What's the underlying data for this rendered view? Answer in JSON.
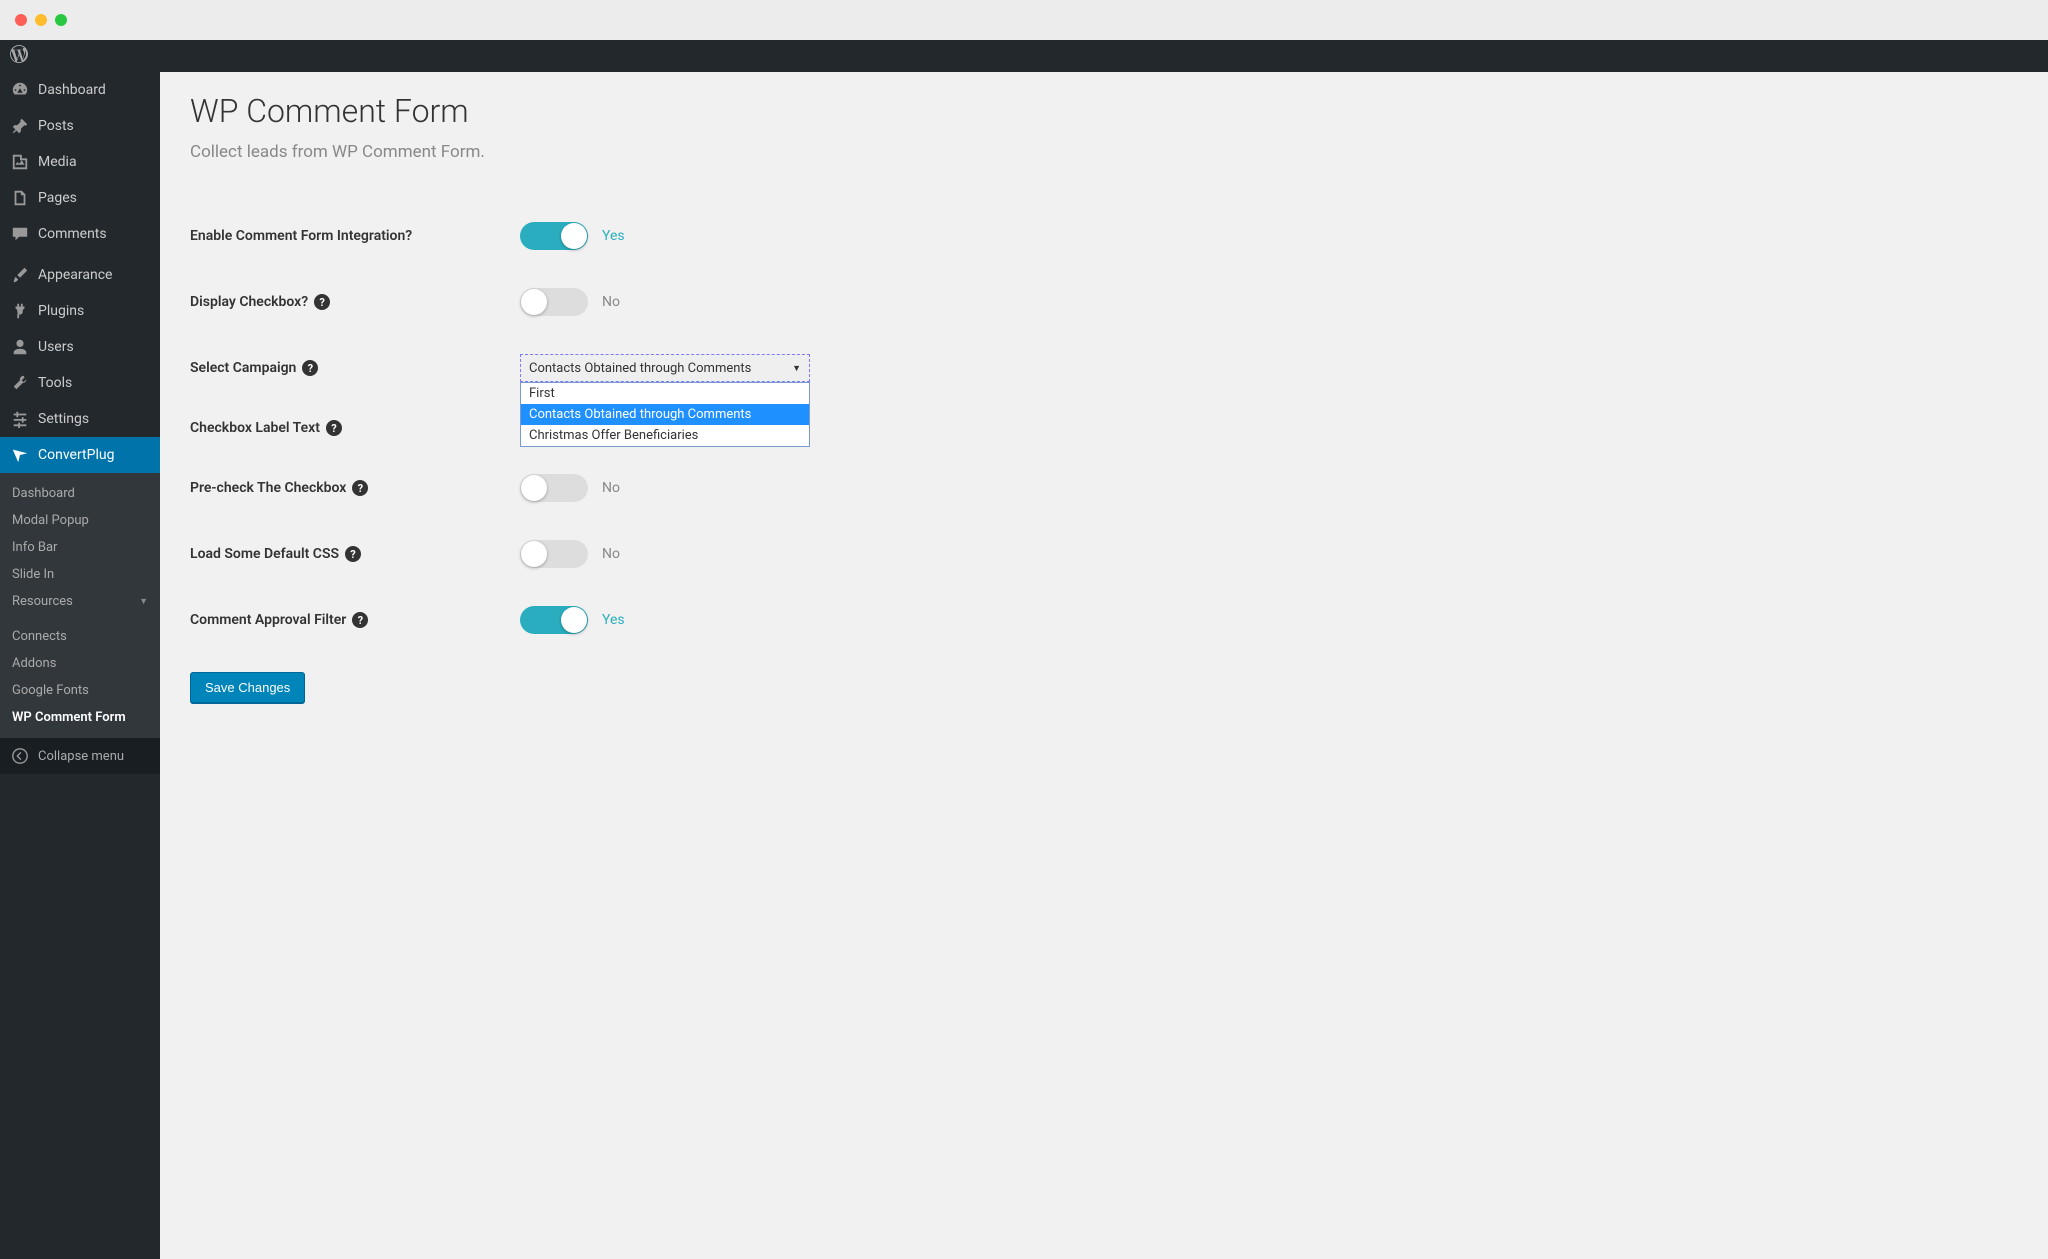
{
  "sidebar": {
    "items": [
      {
        "label": "Dashboard",
        "icon": "dashboard"
      },
      {
        "label": "Posts",
        "icon": "pin"
      },
      {
        "label": "Media",
        "icon": "media"
      },
      {
        "label": "Pages",
        "icon": "pages"
      },
      {
        "label": "Comments",
        "icon": "comment"
      },
      {
        "label": "Appearance",
        "icon": "brush"
      },
      {
        "label": "Plugins",
        "icon": "plug"
      },
      {
        "label": "Users",
        "icon": "user"
      },
      {
        "label": "Tools",
        "icon": "wrench"
      },
      {
        "label": "Settings",
        "icon": "sliders"
      },
      {
        "label": "ConvertPlug",
        "icon": "convertplug"
      }
    ],
    "subitems": [
      {
        "label": "Dashboard"
      },
      {
        "label": "Modal Popup"
      },
      {
        "label": "Info Bar"
      },
      {
        "label": "Slide In"
      },
      {
        "label": "Resources",
        "chevron": true
      },
      {
        "label": "Connects"
      },
      {
        "label": "Addons"
      },
      {
        "label": "Google Fonts"
      },
      {
        "label": "WP Comment Form",
        "current": true
      }
    ],
    "collapse": "Collapse menu"
  },
  "page": {
    "title": "WP Comment Form",
    "subtitle": "Collect leads from WP Comment Form."
  },
  "form": {
    "rows": [
      {
        "label": "Enable Comment Form Integration?",
        "help": false,
        "type": "toggle",
        "value": true
      },
      {
        "label": "Display Checkbox?",
        "help": true,
        "type": "toggle",
        "value": false
      },
      {
        "label": "Select Campaign",
        "help": true,
        "type": "select",
        "selected": "Contacts Obtained through Comments"
      },
      {
        "label": "Checkbox Label Text",
        "help": true,
        "type": "none"
      },
      {
        "label": "Pre-check The Checkbox",
        "help": true,
        "type": "toggle",
        "value": false
      },
      {
        "label": "Load Some Default CSS",
        "help": true,
        "type": "toggle",
        "value": false
      },
      {
        "label": "Comment Approval Filter",
        "help": true,
        "type": "toggle",
        "value": true
      }
    ],
    "toggle_on_text": "Yes",
    "toggle_off_text": "No",
    "select_options": [
      "First",
      "Contacts Obtained through Comments",
      "Christmas Offer Beneficiaries"
    ],
    "submit": "Save Changes"
  }
}
